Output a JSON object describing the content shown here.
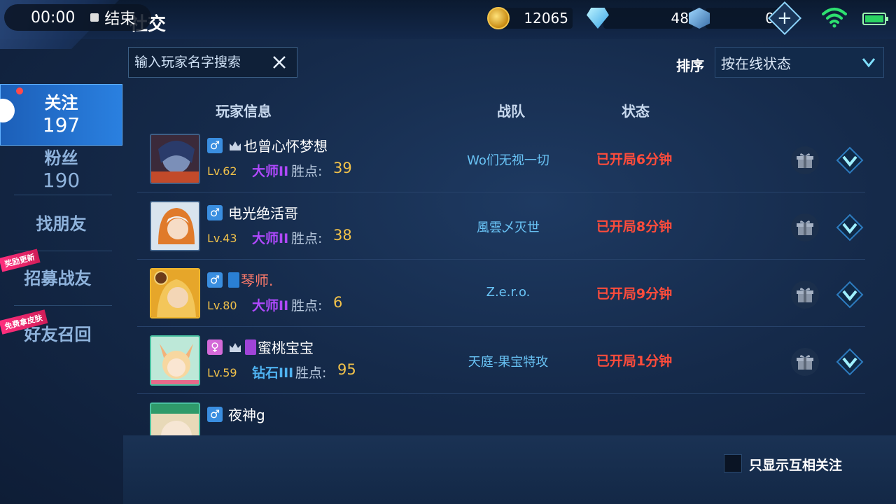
{
  "recording": {
    "time": "00:00",
    "end_label": "结束"
  },
  "header": {
    "title": "社交"
  },
  "currency": {
    "gold": "12065",
    "diamonds": "48",
    "vouchers": "0"
  },
  "sidebar": {
    "follow": {
      "label": "关注",
      "count": "197"
    },
    "fans": {
      "label": "粉丝",
      "count": "190"
    },
    "find_friends": "找朋友",
    "recruit": "招募战友",
    "recruit_ribbon": "奖励更新",
    "recall": "好友召回",
    "recall_ribbon": "免费拿皮肤"
  },
  "search": {
    "placeholder": "输入玩家名字搜索"
  },
  "sort": {
    "label": "排序",
    "value": "按在线状态"
  },
  "columns": {
    "player": "玩家信息",
    "team": "战队",
    "status": "状态"
  },
  "players": [
    {
      "name": "也曾心怀梦想",
      "sex": "♂",
      "level": "Lv.62",
      "rank": "大师II",
      "rank_color": "#b049ff",
      "points_label": "胜点:",
      "points": "39",
      "team": "Wo们无视一切",
      "status": "已开局6分钟"
    },
    {
      "name": "电光绝活哥",
      "sex": "♂",
      "level": "Lv.43",
      "rank": "大师II",
      "rank_color": "#b049ff",
      "points_label": "胜点:",
      "points": "38",
      "team": "風雲乄灭世",
      "status": "已开局8分钟"
    },
    {
      "name": "琴师.",
      "sex": "♂",
      "level": "Lv.80",
      "rank": "大师II",
      "rank_color": "#b049ff",
      "points_label": "胜点:",
      "points": "6",
      "team": "Z.e.r.o.",
      "status": "已开局9分钟"
    },
    {
      "name": "蜜桃宝宝",
      "sex": "♀",
      "level": "Lv.59",
      "rank": "钻石III",
      "rank_color": "#4fb2f0",
      "points_label": "胜点:",
      "points": "95",
      "team": "天庭-果宝特攻",
      "status": "已开局1分钟"
    },
    {
      "name": "夜神g",
      "sex": "♂"
    }
  ],
  "footer": {
    "mutual_only": "只显示互相关注"
  },
  "colors": {
    "accent": "#2a80e0",
    "status_red": "#ff4c3b",
    "points_gold": "#f2c24a",
    "team_blue": "#69c3f5"
  }
}
